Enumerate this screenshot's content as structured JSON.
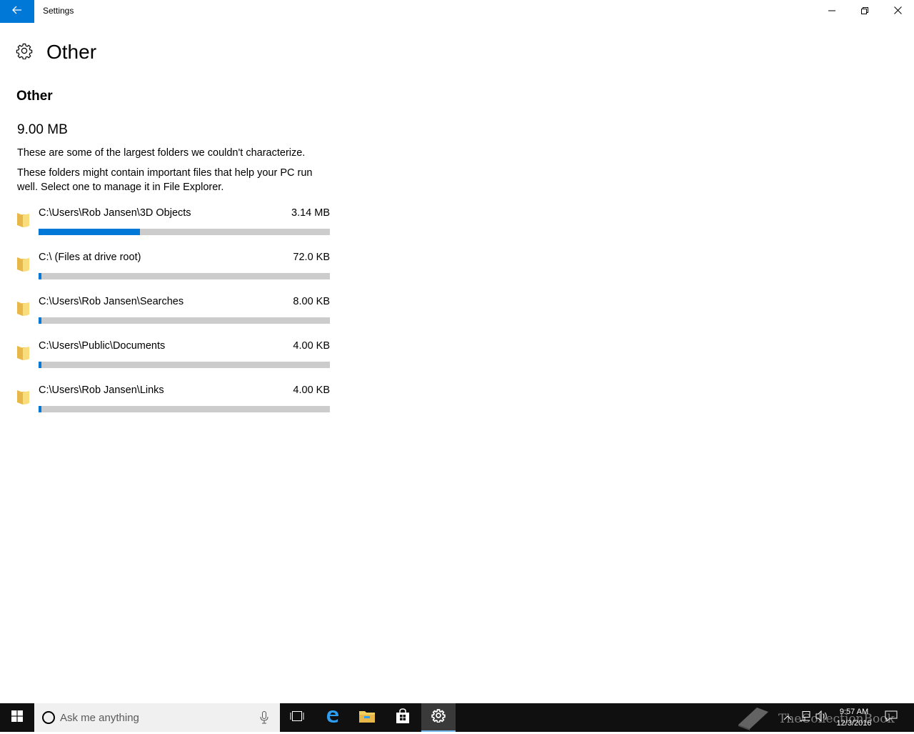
{
  "window": {
    "title": "Settings"
  },
  "header": {
    "page_title": "Other"
  },
  "content": {
    "section_title": "Other",
    "total_size": "9.00 MB",
    "description_1": "These are some of the largest folders we couldn't characterize.",
    "description_2": "These folders might contain important files that help your PC run well. Select one to manage it in File Explorer."
  },
  "folders": [
    {
      "path": "C:\\Users\\Rob Jansen\\3D Objects",
      "size": "3.14 MB",
      "usage_fraction": 0.349
    },
    {
      "path": "C:\\ (Files at drive root)",
      "size": "72.0 KB",
      "usage_fraction": 0.008
    },
    {
      "path": "C:\\Users\\Rob Jansen\\Searches",
      "size": "8.00 KB",
      "usage_fraction": 0.001
    },
    {
      "path": "C:\\Users\\Public\\Documents",
      "size": "4.00 KB",
      "usage_fraction": 0.0005
    },
    {
      "path": "C:\\Users\\Rob Jansen\\Links",
      "size": "4.00 KB",
      "usage_fraction": 0.0005
    }
  ],
  "taskbar": {
    "search_placeholder": "Ask me anything",
    "time": "9:57 AM",
    "date": "12/3/2016",
    "watermark": "TheCollectionBook"
  },
  "colors": {
    "accent": "#0078d7",
    "bar_track": "#cccccc",
    "folder_yellow": "#f5cf5c",
    "taskbar_bg": "#101010"
  }
}
